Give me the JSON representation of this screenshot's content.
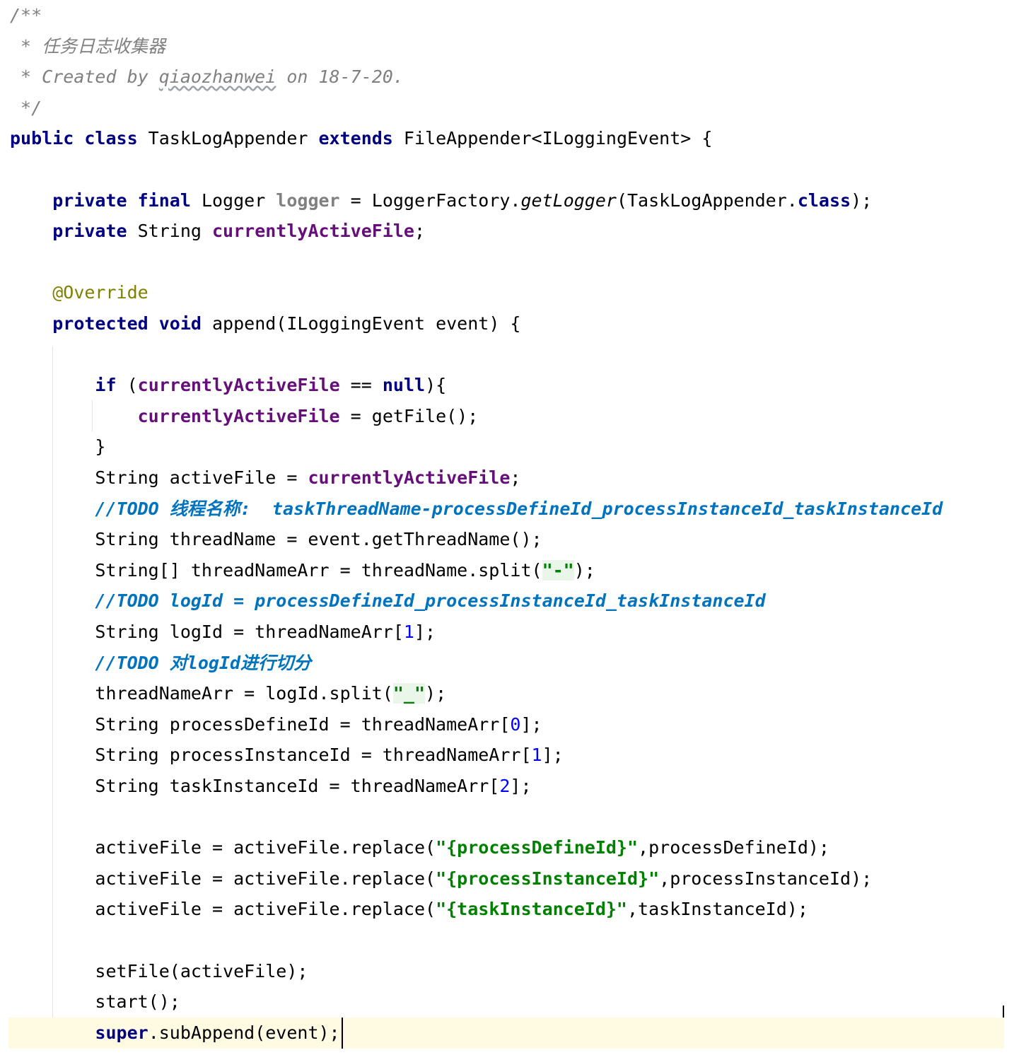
{
  "editor": {
    "language": "Java",
    "lines": [
      {
        "tokens": [
          {
            "t": "/**",
            "c": "comment"
          }
        ]
      },
      {
        "tokens": [
          {
            "t": " * 任务日志收集器",
            "c": "comment"
          }
        ]
      },
      {
        "tokens": [
          {
            "t": " * Created by ",
            "c": "comment"
          },
          {
            "t": "qiaozhanwei",
            "c": "comment squiggle"
          },
          {
            "t": " on 18-7-20.",
            "c": "comment"
          }
        ]
      },
      {
        "tokens": [
          {
            "t": " */",
            "c": "comment"
          }
        ]
      },
      {
        "tokens": [
          {
            "t": "public class ",
            "c": "kw"
          },
          {
            "t": "TaskLogAppender ",
            "c": "plain"
          },
          {
            "t": "extends ",
            "c": "kw"
          },
          {
            "t": "FileAppender<ILoggingEvent> {",
            "c": "plain"
          }
        ]
      },
      {
        "tokens": []
      },
      {
        "tokens": [
          {
            "t": "    ",
            "c": "plain"
          },
          {
            "t": "private final ",
            "c": "kw"
          },
          {
            "t": "Logger ",
            "c": "plain"
          },
          {
            "t": "logger",
            "c": "grayfield"
          },
          {
            "t": " = LoggerFactory.",
            "c": "plain"
          },
          {
            "t": "getLogger",
            "c": "method-static"
          },
          {
            "t": "(TaskLogAppender.",
            "c": "plain"
          },
          {
            "t": "class",
            "c": "kw"
          },
          {
            "t": ");",
            "c": "plain"
          }
        ]
      },
      {
        "tokens": [
          {
            "t": "    ",
            "c": "plain"
          },
          {
            "t": "private ",
            "c": "kw"
          },
          {
            "t": "String ",
            "c": "plain"
          },
          {
            "t": "currentlyActiveFile",
            "c": "field"
          },
          {
            "t": ";",
            "c": "plain"
          }
        ]
      },
      {
        "tokens": []
      },
      {
        "tokens": [
          {
            "t": "    ",
            "c": "plain"
          },
          {
            "t": "@Override",
            "c": "annot"
          }
        ]
      },
      {
        "tokens": [
          {
            "t": "    ",
            "c": "plain"
          },
          {
            "t": "protected void ",
            "c": "kw"
          },
          {
            "t": "append(ILoggingEvent event) {",
            "c": "plain"
          }
        ]
      },
      {
        "tokens": []
      },
      {
        "tokens": [
          {
            "t": "        ",
            "c": "plain"
          },
          {
            "t": "if ",
            "c": "kw"
          },
          {
            "t": "(",
            "c": "plain"
          },
          {
            "t": "currentlyActiveFile",
            "c": "field"
          },
          {
            "t": " == ",
            "c": "plain"
          },
          {
            "t": "null",
            "c": "kw"
          },
          {
            "t": "){",
            "c": "plain"
          }
        ]
      },
      {
        "tokens": [
          {
            "t": "            ",
            "c": "plain"
          },
          {
            "t": "currentlyActiveFile",
            "c": "field"
          },
          {
            "t": " = getFile();",
            "c": "plain"
          }
        ]
      },
      {
        "tokens": [
          {
            "t": "        }",
            "c": "plain"
          }
        ]
      },
      {
        "tokens": [
          {
            "t": "        String activeFile = ",
            "c": "plain"
          },
          {
            "t": "currentlyActiveFile",
            "c": "field"
          },
          {
            "t": ";",
            "c": "plain"
          }
        ]
      },
      {
        "tokens": [
          {
            "t": "        ",
            "c": "plain"
          },
          {
            "t": "//TODO 线程名称:  taskThreadName-processDefineId_processInstanceId_taskInstanceId",
            "c": "todo"
          }
        ]
      },
      {
        "tokens": [
          {
            "t": "        String threadName = event.getThreadName();",
            "c": "plain"
          }
        ]
      },
      {
        "tokens": [
          {
            "t": "        String[] threadNameArr = threadName.split(",
            "c": "plain"
          },
          {
            "t": "\"-\"",
            "c": "str str-hl"
          },
          {
            "t": ");",
            "c": "plain"
          }
        ]
      },
      {
        "tokens": [
          {
            "t": "        ",
            "c": "plain"
          },
          {
            "t": "//TODO logId = processDefineId_processInstanceId_taskInstanceId",
            "c": "todo"
          }
        ]
      },
      {
        "tokens": [
          {
            "t": "        String logId = threadNameArr[",
            "c": "plain"
          },
          {
            "t": "1",
            "c": "num"
          },
          {
            "t": "];",
            "c": "plain"
          }
        ]
      },
      {
        "tokens": [
          {
            "t": "        ",
            "c": "plain"
          },
          {
            "t": "//TODO 对logId进行切分",
            "c": "todo"
          }
        ]
      },
      {
        "tokens": [
          {
            "t": "        threadNameArr = logId.split(",
            "c": "plain"
          },
          {
            "t": "\"_\"",
            "c": "str str-hl"
          },
          {
            "t": ");",
            "c": "plain"
          }
        ]
      },
      {
        "tokens": [
          {
            "t": "        String processDefineId = threadNameArr[",
            "c": "plain"
          },
          {
            "t": "0",
            "c": "num"
          },
          {
            "t": "];",
            "c": "plain"
          }
        ]
      },
      {
        "tokens": [
          {
            "t": "        String processInstanceId = threadNameArr[",
            "c": "plain"
          },
          {
            "t": "1",
            "c": "num"
          },
          {
            "t": "];",
            "c": "plain"
          }
        ]
      },
      {
        "tokens": [
          {
            "t": "        String taskInstanceId = threadNameArr[",
            "c": "plain"
          },
          {
            "t": "2",
            "c": "num"
          },
          {
            "t": "];",
            "c": "plain"
          }
        ]
      },
      {
        "tokens": []
      },
      {
        "tokens": [
          {
            "t": "        activeFile = activeFile.replace(",
            "c": "plain"
          },
          {
            "t": "\"{processDefineId}\"",
            "c": "str"
          },
          {
            "t": ",processDefineId);",
            "c": "plain"
          }
        ]
      },
      {
        "tokens": [
          {
            "t": "        activeFile = activeFile.replace(",
            "c": "plain"
          },
          {
            "t": "\"{processInstanceId}\"",
            "c": "str"
          },
          {
            "t": ",processInstanceId);",
            "c": "plain"
          }
        ]
      },
      {
        "tokens": [
          {
            "t": "        activeFile = activeFile.replace(",
            "c": "plain"
          },
          {
            "t": "\"{taskInstanceId}\"",
            "c": "str"
          },
          {
            "t": ",taskInstanceId);",
            "c": "plain"
          }
        ]
      },
      {
        "tokens": []
      },
      {
        "tokens": [
          {
            "t": "        setFile(activeFile);",
            "c": "plain"
          }
        ]
      },
      {
        "tokens": [
          {
            "t": "        start();",
            "c": "plain"
          }
        ]
      },
      {
        "tokens": [
          {
            "t": "        ",
            "c": "plain"
          },
          {
            "t": "super",
            "c": "kw"
          },
          {
            "t": ".subAppend(event);",
            "c": "plain"
          }
        ],
        "current": true
      }
    ]
  },
  "colors": {
    "keyword": "#000080",
    "field": "#660e7a",
    "comment": "#808080",
    "todo": "#0073bf",
    "annotation": "#808000",
    "string": "#008000",
    "number": "#0000ff",
    "current_line": "#fffbe3"
  }
}
